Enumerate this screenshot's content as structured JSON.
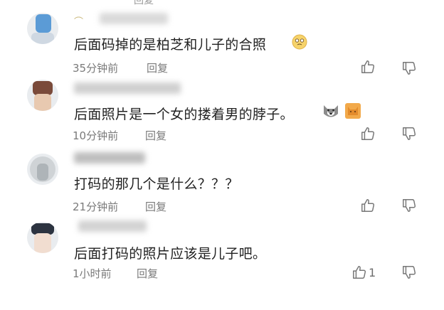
{
  "top_partial": {
    "reply_label": "回复"
  },
  "comments": [
    {
      "text": "后面码掉的是柏芝和儿子的合照",
      "time": "35分钟前",
      "reply_label": "回复",
      "emoji": [
        "face-emoji"
      ]
    },
    {
      "text": "后面照片是一个女的搂着男的脖子。",
      "time": "10分钟前",
      "reply_label": "回复",
      "emoji": [
        "husky-emoji",
        "cat-emoji"
      ]
    },
    {
      "text": "打码的那几个是什么？？？",
      "time": "21分钟前",
      "reply_label": "回复",
      "emoji": []
    },
    {
      "text": "后面打码的照片应该是儿子吧。",
      "time": "1小时前",
      "reply_label": "回复",
      "like_count": "1",
      "emoji": []
    }
  ],
  "colors": {
    "text": "#222222",
    "meta": "#7a7a7a",
    "icon": "#777777"
  }
}
